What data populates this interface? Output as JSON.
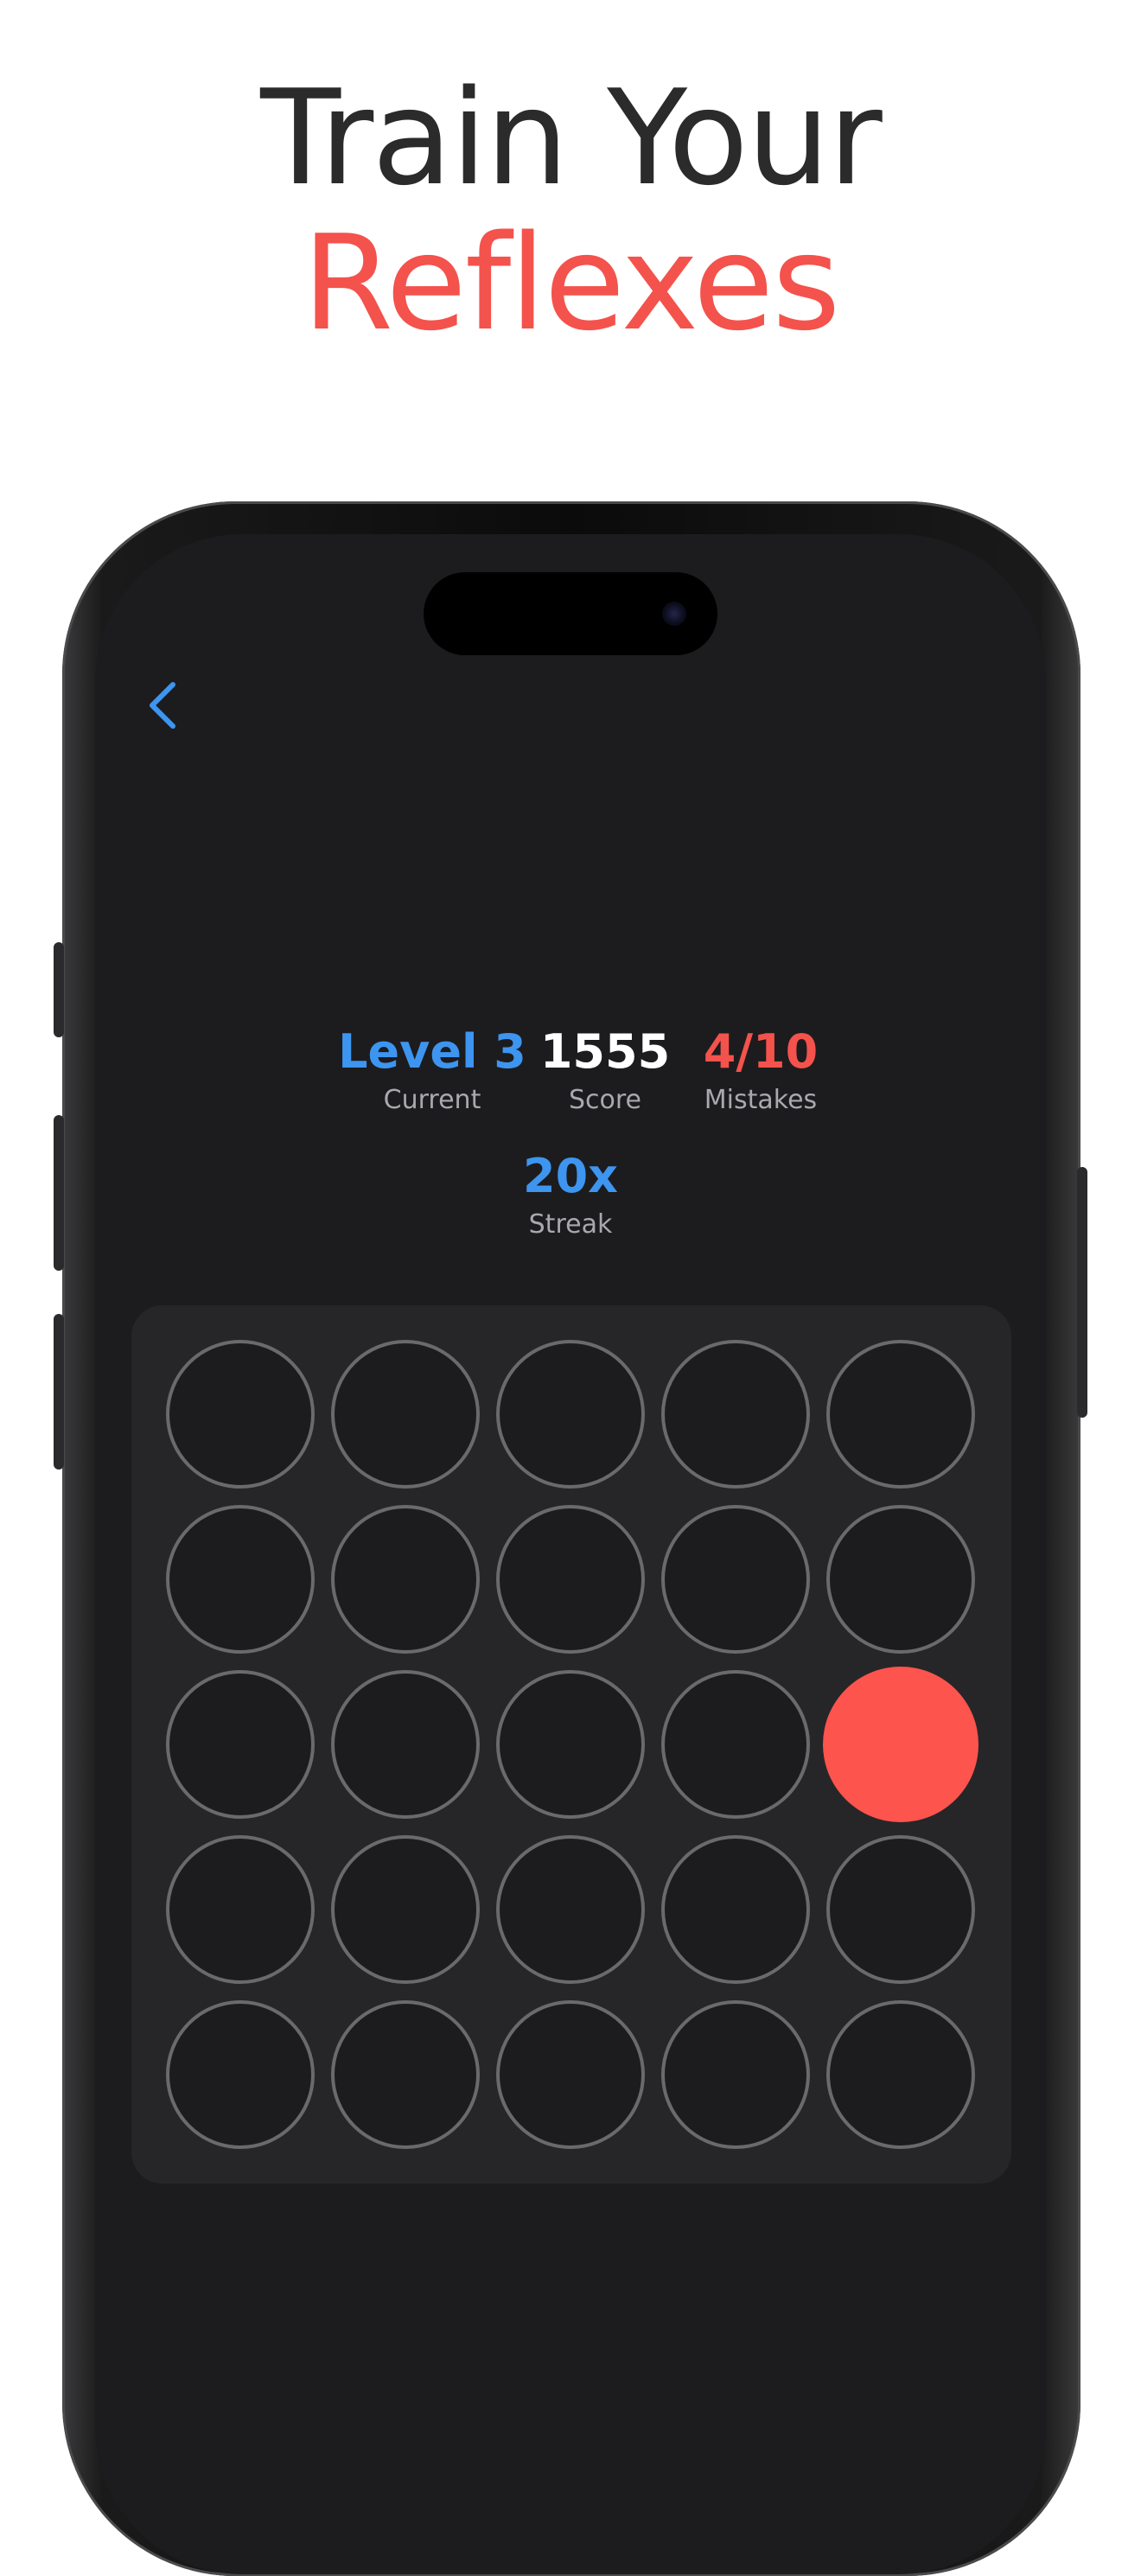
{
  "headline": {
    "line1": "Train Your",
    "line2": "Reflexes"
  },
  "colors": {
    "accent_blue": "#3d95f0",
    "accent_red": "#f4524c",
    "active_target": "#fd544d",
    "screen_bg": "#1c1c1e",
    "board_bg": "#262628"
  },
  "nav": {
    "back_icon": "chevron-left-icon"
  },
  "stats": {
    "level": {
      "value": "Level 3",
      "label": "Current"
    },
    "score": {
      "value": "1555",
      "label": "Score"
    },
    "mistakes": {
      "value": "4/10",
      "label": "Mistakes"
    },
    "streak": {
      "value": "20x",
      "label": "Streak"
    }
  },
  "grid": {
    "rows": 5,
    "cols": 5,
    "active_cell": {
      "row": 3,
      "col": 5
    }
  }
}
